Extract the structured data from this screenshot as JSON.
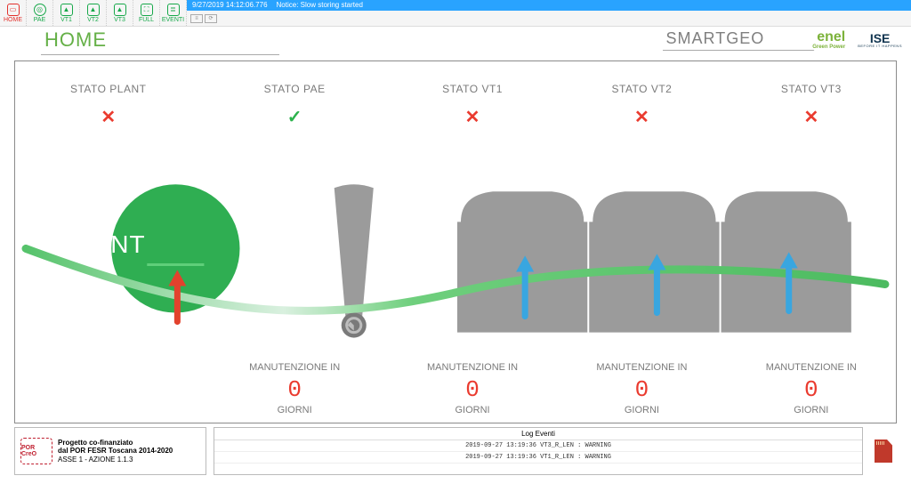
{
  "app": {
    "notice_time": "9/27/2019 14:12:06.776",
    "notice_text": "Notice: Slow storing started"
  },
  "toolbar": {
    "items": [
      {
        "label": "HOME"
      },
      {
        "label": "PAE"
      },
      {
        "label": "VT1"
      },
      {
        "label": "VT2"
      },
      {
        "label": "VT3"
      },
      {
        "label": "FULL"
      },
      {
        "label": "EVENTI"
      }
    ]
  },
  "header": {
    "title": "HOME",
    "brand_app": "SMARTGEO",
    "brand_2": "enel",
    "brand_2_sub": "Green Power",
    "brand_3": "ISE",
    "brand_3_sub": "BEFORE IT HAPPENS"
  },
  "status": {
    "plant": {
      "label": "STATO PLANT",
      "ok": false
    },
    "pae": {
      "label": "STATO PAE",
      "ok": true,
      "maint_label": "MANUTENZIONE IN",
      "days": "0",
      "unit": "GIORNI"
    },
    "vt1": {
      "label": "STATO VT1",
      "ok": false,
      "maint_label": "MANUTENZIONE IN",
      "days": "0",
      "unit": "GIORNI"
    },
    "vt2": {
      "label": "STATO VT2",
      "ok": false,
      "maint_label": "MANUTENZIONE IN",
      "days": "0",
      "unit": "GIORNI"
    },
    "vt3": {
      "label": "STATO VT3",
      "ok": false,
      "maint_label": "MANUTENZIONE IN",
      "days": "0",
      "unit": "GIORNI"
    }
  },
  "plant_circle_label": "PLANT",
  "footer": {
    "project_title": "Progetto co-finanziato",
    "project_line2": "dal POR FESR Toscana 2014-2020",
    "project_line3": "ASSE 1 - AZIONE 1.1.3",
    "logo_text": "POR CreO",
    "log_title": "Log Eventi",
    "log_rows": [
      "2019-09-27 13:19:36 VT3_R_LEN : WARNING",
      "2019-09-27 13:19:36 VT1_R_LEN : WARNING"
    ]
  }
}
